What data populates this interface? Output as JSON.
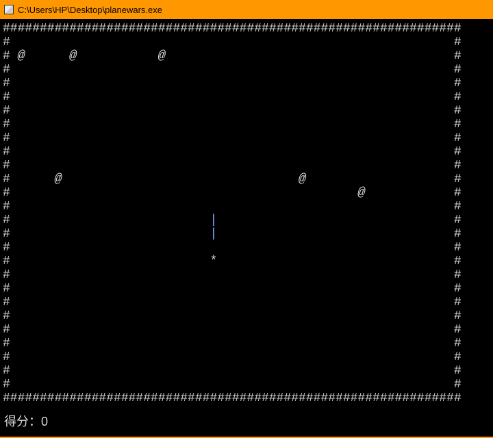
{
  "titlebar": {
    "path": "C:\\Users\\HP\\Desktop\\planewars.exe"
  },
  "game": {
    "cols": 62,
    "rows": 28,
    "border_char": "#",
    "enemy_char": "@",
    "bullet_char": "|",
    "player_char": "*",
    "enemies": [
      {
        "row": 2,
        "col": 2
      },
      {
        "row": 2,
        "col": 9
      },
      {
        "row": 2,
        "col": 21
      },
      {
        "row": 11,
        "col": 7
      },
      {
        "row": 11,
        "col": 40
      },
      {
        "row": 12,
        "col": 48
      }
    ],
    "bullets": [
      {
        "row": 14,
        "col": 28
      },
      {
        "row": 15,
        "col": 28
      }
    ],
    "player": {
      "row": 17,
      "col": 28
    }
  },
  "score": {
    "label": "得分：",
    "value": "0"
  }
}
